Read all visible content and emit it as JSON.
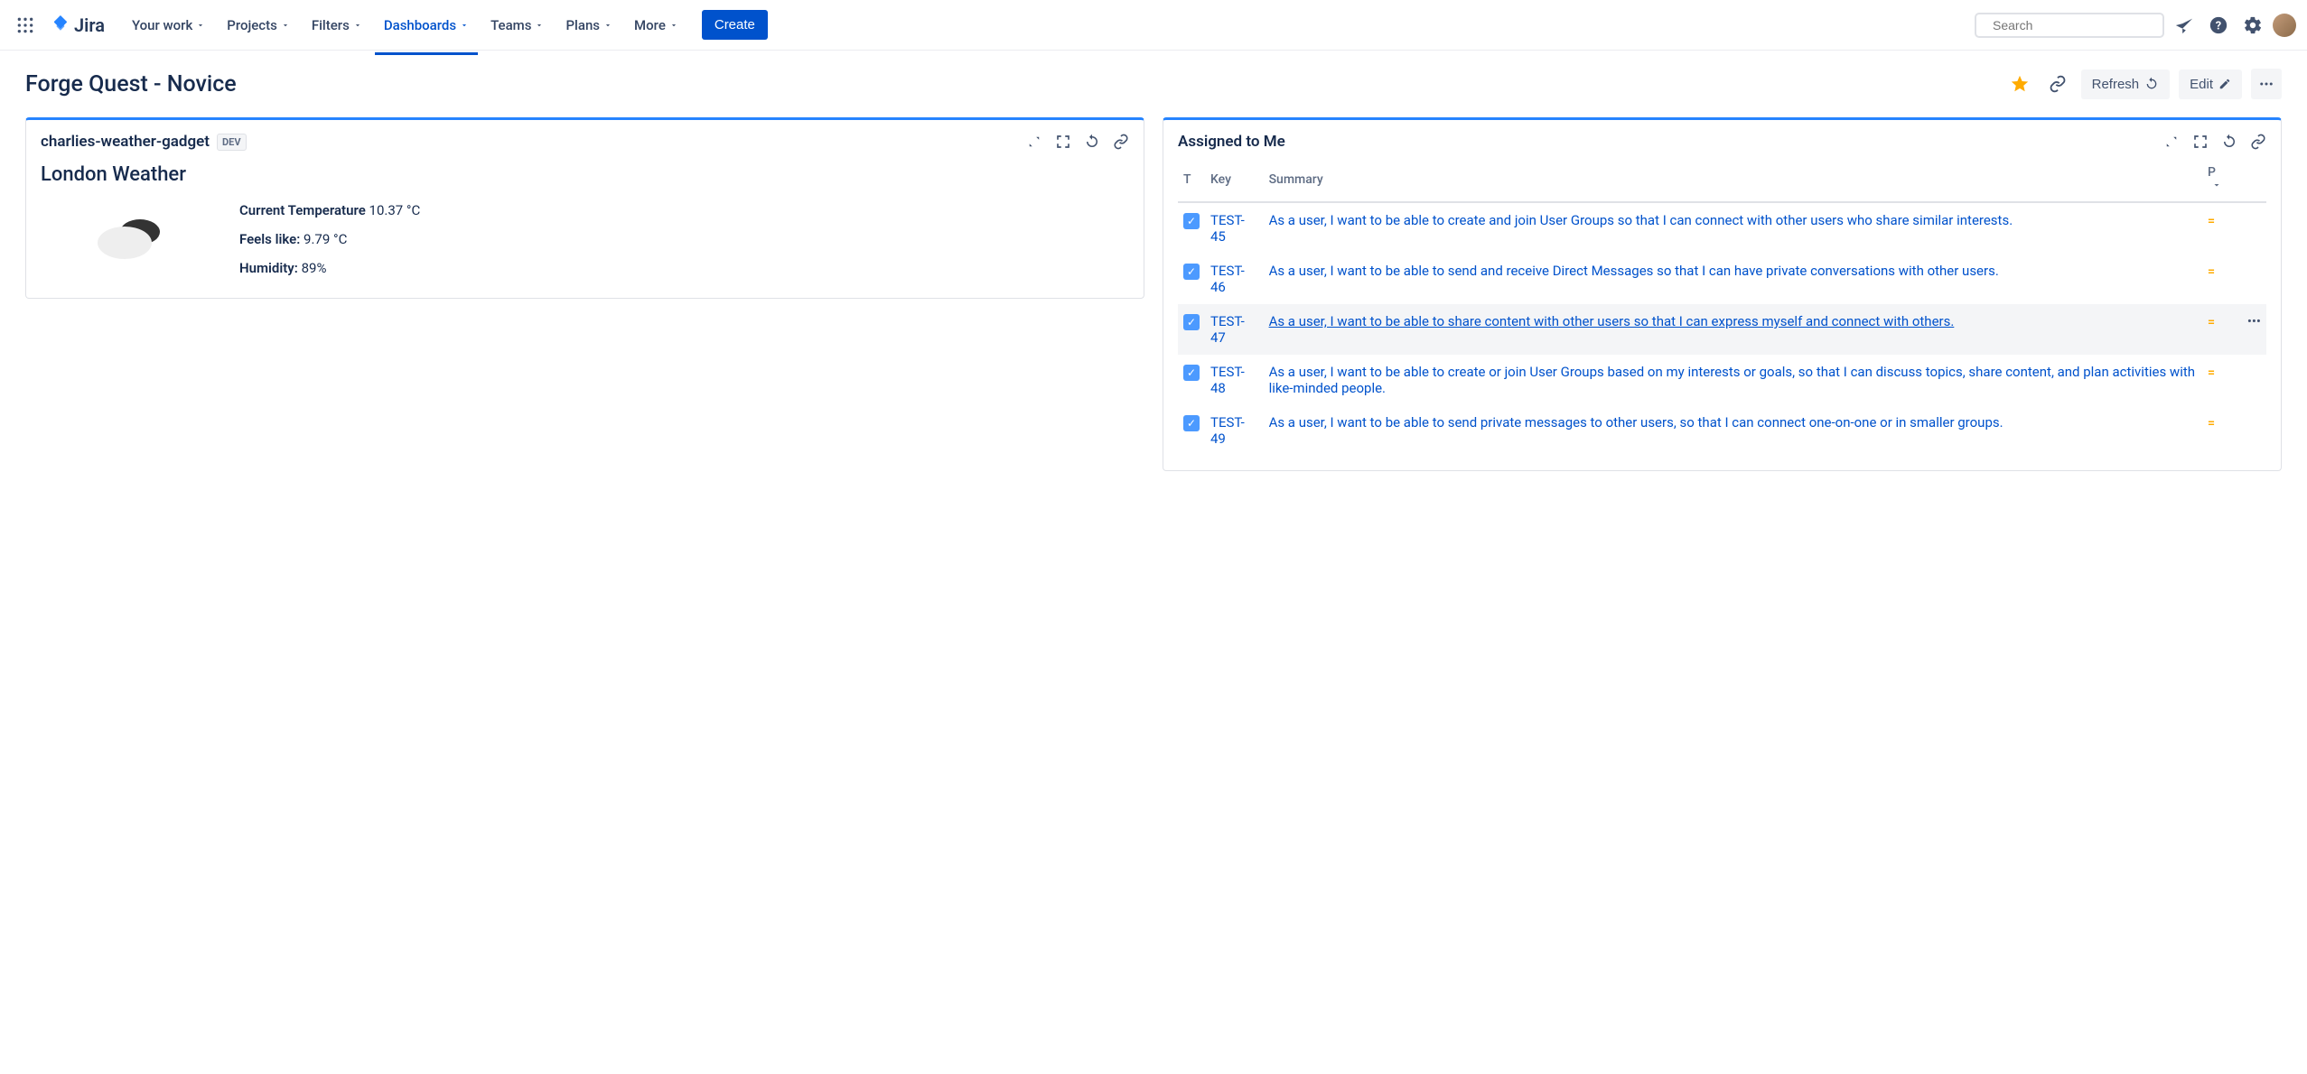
{
  "brand": {
    "product": "Jira"
  },
  "nav": {
    "your_work": "Your work",
    "projects": "Projects",
    "filters": "Filters",
    "dashboards": "Dashboards",
    "teams": "Teams",
    "plans": "Plans",
    "more": "More",
    "create": "Create"
  },
  "search": {
    "placeholder": "Search"
  },
  "page": {
    "title": "Forge Quest - Novice",
    "refresh": "Refresh",
    "edit": "Edit"
  },
  "gadgets": {
    "weather": {
      "name": "charlies-weather-gadget",
      "badge": "DEV",
      "title": "London Weather",
      "temp_label": "Current Temperature",
      "temp": "10.37 °C",
      "feels_label": "Feels like:",
      "feels": "9.79 °C",
      "humidity_label": "Humidity:",
      "humidity": "89%"
    },
    "assigned": {
      "title": "Assigned to Me",
      "cols": {
        "t": "T",
        "key": "Key",
        "summary": "Summary",
        "p": "P"
      },
      "rows": [
        {
          "key": "TEST-45",
          "summary": "As a user, I want to be able to create and join User Groups so that I can connect with other users who share similar interests."
        },
        {
          "key": "TEST-46",
          "summary": "As a user, I want to be able to send and receive Direct Messages so that I can have private conversations with other users."
        },
        {
          "key": "TEST-47",
          "summary": "As a user, I want to be able to share content with other users so that I can express myself and connect with others.",
          "hover": true
        },
        {
          "key": "TEST-48",
          "summary": "As a user, I want to be able to create or join User Groups based on my interests or goals, so that I can discuss topics, share content, and plan activities with like-minded people."
        },
        {
          "key": "TEST-49",
          "summary": "As a user, I want to be able to send private messages to other users, so that I can connect one-on-one or in smaller groups."
        }
      ]
    }
  }
}
